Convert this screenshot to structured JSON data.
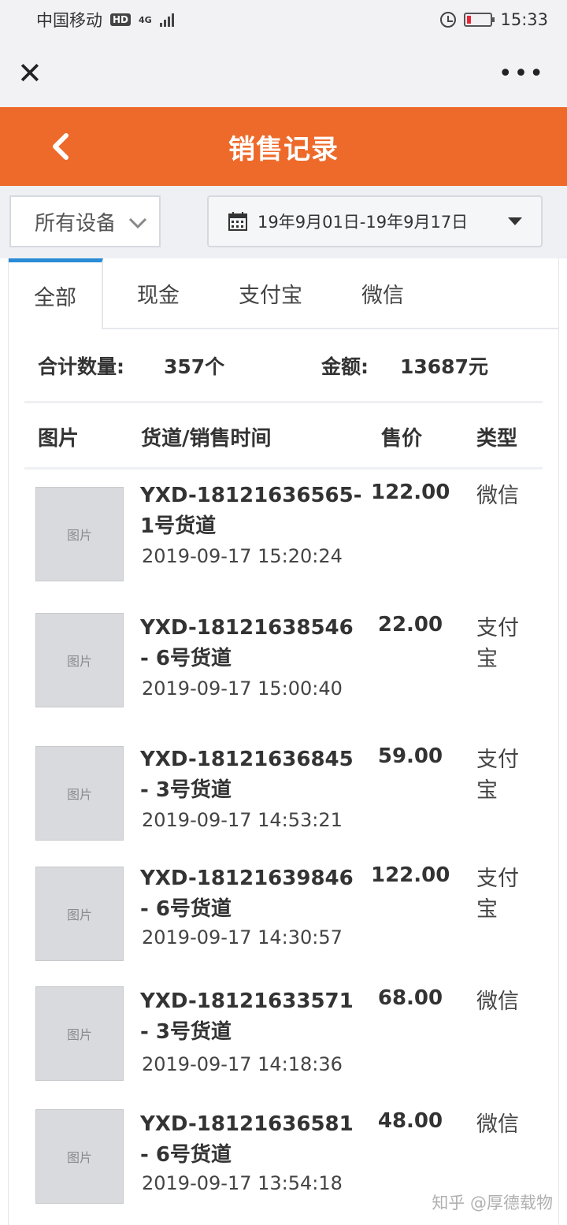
{
  "status_bar": {
    "carrier": "中国移动",
    "hd": "HD",
    "network": "4G",
    "time": "15:33"
  },
  "header": {
    "title": "销售记录"
  },
  "filters": {
    "device": "所有设备",
    "date_range": "19年9月01日-19年9月17日"
  },
  "tabs": [
    "全部",
    "现金",
    "支付宝",
    "微信"
  ],
  "summary": {
    "count_label": "合计数量:",
    "count_value": "357个",
    "amount_label": "金额:",
    "amount_value": "13687元"
  },
  "columns": {
    "image": "图片",
    "lane_time": "货道/销售时间",
    "price": "售价",
    "type": "类型"
  },
  "rows": [
    {
      "lane": "YXD-18121636565-1号货道",
      "time": "2019-09-17 15:20:24",
      "price": "122.00",
      "type": "微信"
    },
    {
      "lane": "YXD-18121638546 - 6号货道",
      "time": "2019-09-17 15:00:40",
      "price": "22.00",
      "type": "支付宝"
    },
    {
      "lane": "YXD-18121636845 - 3号货道",
      "time": "2019-09-17 14:53:21",
      "price": "59.00",
      "type": "支付宝"
    },
    {
      "lane": "YXD-18121639846 - 6号货道",
      "time": "2019-09-17 14:30:57",
      "price": "122.00",
      "type": "支付宝"
    },
    {
      "lane": "YXD-18121633571 - 3号货道",
      "time": "2019-09-17 14:18:36",
      "price": "68.00",
      "type": "微信"
    },
    {
      "lane": "YXD-18121636581 - 6号货道",
      "time": "2019-09-17 13:54:18",
      "price": "48.00",
      "type": "微信"
    }
  ],
  "watermark": "知乎 @厚德载物",
  "colors": {
    "header_bg": "#ee6a2a",
    "tab_active_accent": "#2a8bd6"
  }
}
